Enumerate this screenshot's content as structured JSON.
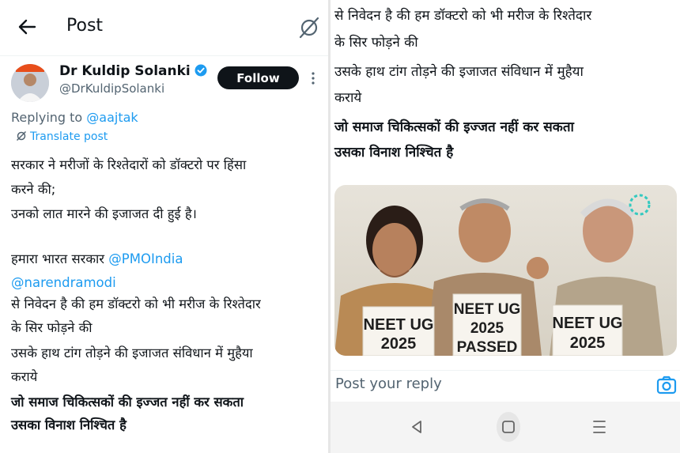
{
  "header": {
    "title": "Post"
  },
  "author": {
    "name": "Dr Kuldip Solanki",
    "handle": "@DrKuldipSolanki",
    "follow_label": "Follow"
  },
  "reply_context": {
    "prefix": "Replying to ",
    "mention": "@aajtak"
  },
  "translate_label": "Translate post",
  "tweet": {
    "line1": "सरकार ने मरीजों के रिश्तेदारों को डॉक्टरो  पर हिंसा",
    "line2": "करने की;",
    "line3": " उनको लात मारने की इजाजत दी हुई है।",
    "line4_prefix": " हमारा भारत सरकार ",
    "line4_mention": "@PMOIndia",
    "line5_mention": "@narendramodi",
    "line6": "से निवेदन है की हम डॉक्टरो को भी मरीज के रिश्तेदार",
    "line7": "के सिर फोड़ने की",
    "line8": "  उसके हाथ टांग तोड़ने की इजाजत संविधान में  मुहैया",
    "line9": "कराये",
    "bold1": "जो समाज  चिकित्सकों की इज्जत नहीं कर सकता",
    "bold2": "उसका विनाश निश्चित है"
  },
  "right_text": {
    "line1": "से निवेदन है की हम डॉक्टरो को भी मरीज के रिश्तेदार",
    "line2": "के सिर फोड़ने की",
    "line3": "  उसके हाथ टांग तोड़ने की इजाजत संविधान में  मुहैया",
    "line4": "कराये",
    "bold1": "जो समाज  चिकित्सकों की इज्जत नहीं कर सकता",
    "bold2": "उसका विनाश निश्चित है"
  },
  "image_signs": {
    "sign1_l1": "NEET UG",
    "sign1_l2": "2025",
    "sign2_l1": "NEET UG",
    "sign2_l2": "2025",
    "sign2_l3": "PASSED",
    "sign3_l1": "NEET UG",
    "sign3_l2": "2025"
  },
  "reply_placeholder": "Post your reply",
  "colors": {
    "accent": "#1d9bf0",
    "follow_bg": "#0f1419",
    "muted": "#536471"
  },
  "icons": [
    "back-arrow-icon",
    "grok-slash-icon",
    "verified-icon",
    "more-icon",
    "translate-icon",
    "camera-icon",
    "nav-back-icon",
    "nav-home-icon",
    "nav-menu-icon"
  ]
}
